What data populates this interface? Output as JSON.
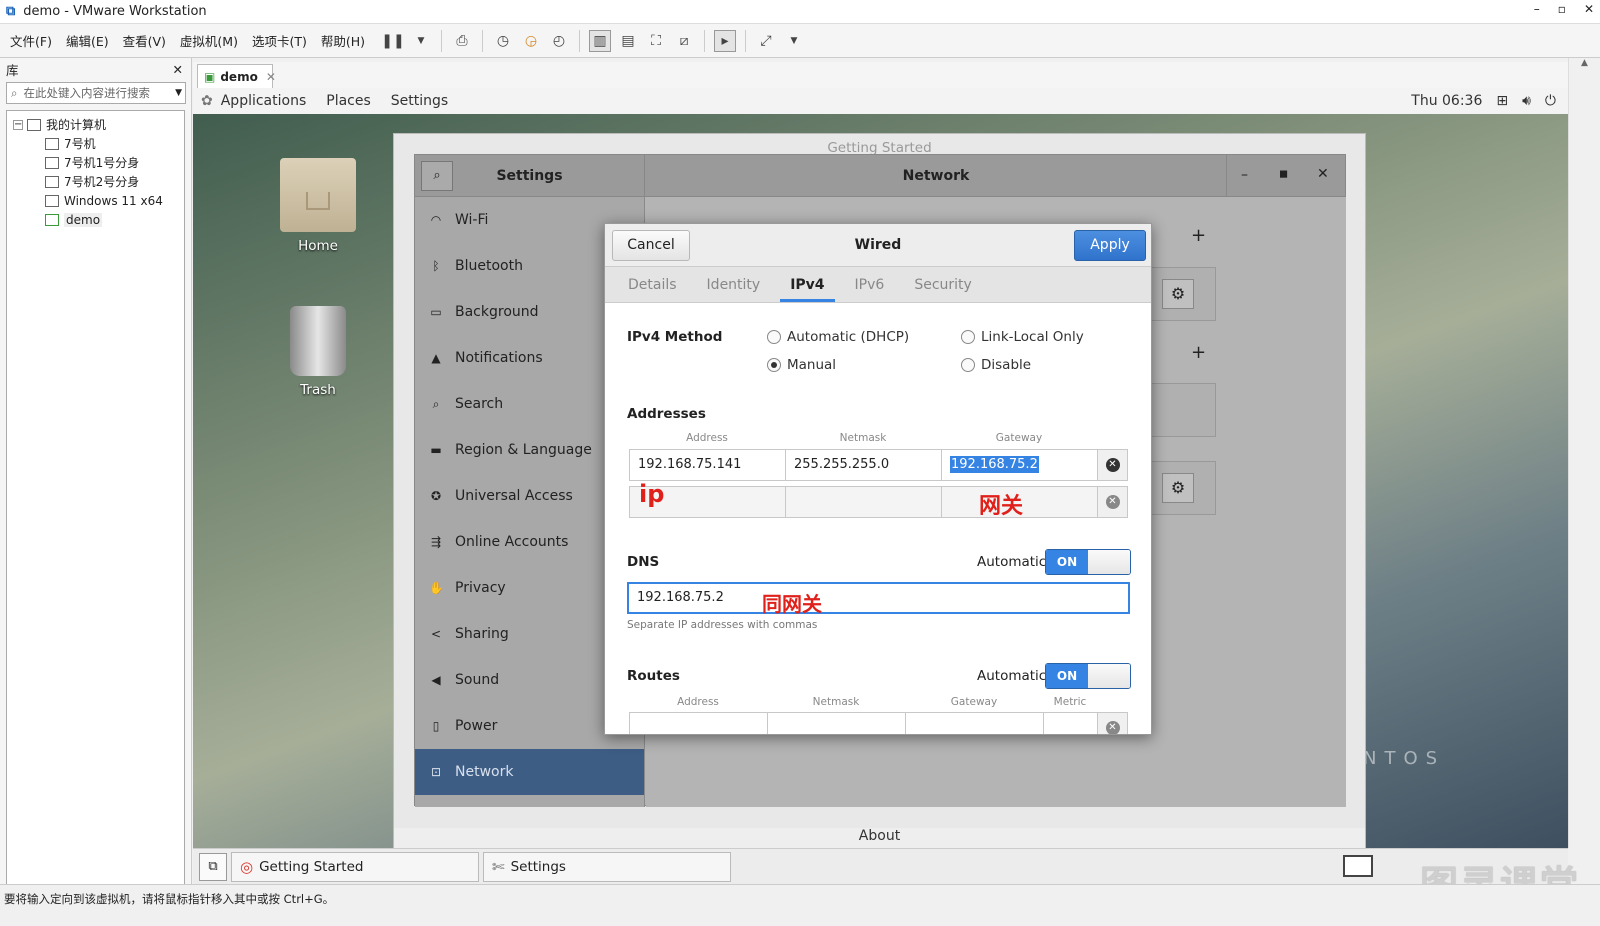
{
  "window": {
    "title": "demo - VMware Workstation",
    "controls": [
      "–",
      "▫",
      "✕"
    ]
  },
  "menus": [
    "文件(F)",
    "编辑(E)",
    "查看(V)",
    "虚拟机(M)",
    "选项卡(T)",
    "帮助(H)"
  ],
  "library": {
    "title": "库",
    "close": "✕",
    "search_placeholder": "在此处键入内容进行搜索",
    "root": "我的计算机",
    "items": [
      "7号机",
      "7号机1号分身",
      "7号机2号分身",
      "Windows 11 x64",
      "demo"
    ]
  },
  "vm_tab": {
    "label": "demo",
    "close": "✕"
  },
  "gnome": {
    "menus": [
      "Applications",
      "Places",
      "Settings"
    ],
    "clock": "Thu 06:36"
  },
  "desktop": {
    "icons": [
      "Home",
      "Trash"
    ]
  },
  "getting_started": {
    "title": "Getting Started",
    "about": "About"
  },
  "settings": {
    "title": "Settings",
    "panel_title": "Network",
    "sidebar": [
      "Wi-Fi",
      "Bluetooth",
      "Background",
      "Notifications",
      "Search",
      "Region & Language",
      "Universal Access",
      "Online Accounts",
      "Privacy",
      "Sharing",
      "Sound",
      "Power",
      "Network"
    ],
    "active": "Network"
  },
  "wired": {
    "title": "Wired",
    "cancel": "Cancel",
    "apply": "Apply",
    "tabs": [
      "Details",
      "Identity",
      "IPv4",
      "IPv6",
      "Security"
    ],
    "active_tab": "IPv4",
    "method_label": "IPv4 Method",
    "methods": [
      "Automatic (DHCP)",
      "Link-Local Only",
      "Manual",
      "Disable"
    ],
    "selected_method": "Manual",
    "addresses_label": "Addresses",
    "col_address": "Address",
    "col_netmask": "Netmask",
    "col_gateway": "Gateway",
    "address": "192.168.75.141",
    "netmask": "255.255.255.0",
    "gateway": "192.168.75.2",
    "dns_label": "DNS",
    "automatic": "Automatic",
    "on": "ON",
    "dns_value": "192.168.75.2",
    "dns_hint": "Separate IP addresses with commas",
    "routes_label": "Routes",
    "col_metric": "Metric"
  },
  "annotations": {
    "ip": "ip",
    "gateway": "网关",
    "dns": "同网关"
  },
  "taskbar": {
    "items": [
      "Getting Started",
      "Settings"
    ]
  },
  "statusbar": "要将输入定向到该虚拟机，请将鼠标指针移入其中或按 Ctrl+G。",
  "watermark": "图灵课堂",
  "centos_text": "NTOS",
  "colors": {
    "accent": "#3584e4",
    "annotation": "#e0201a",
    "sidebar_active": "#3d5d85"
  }
}
